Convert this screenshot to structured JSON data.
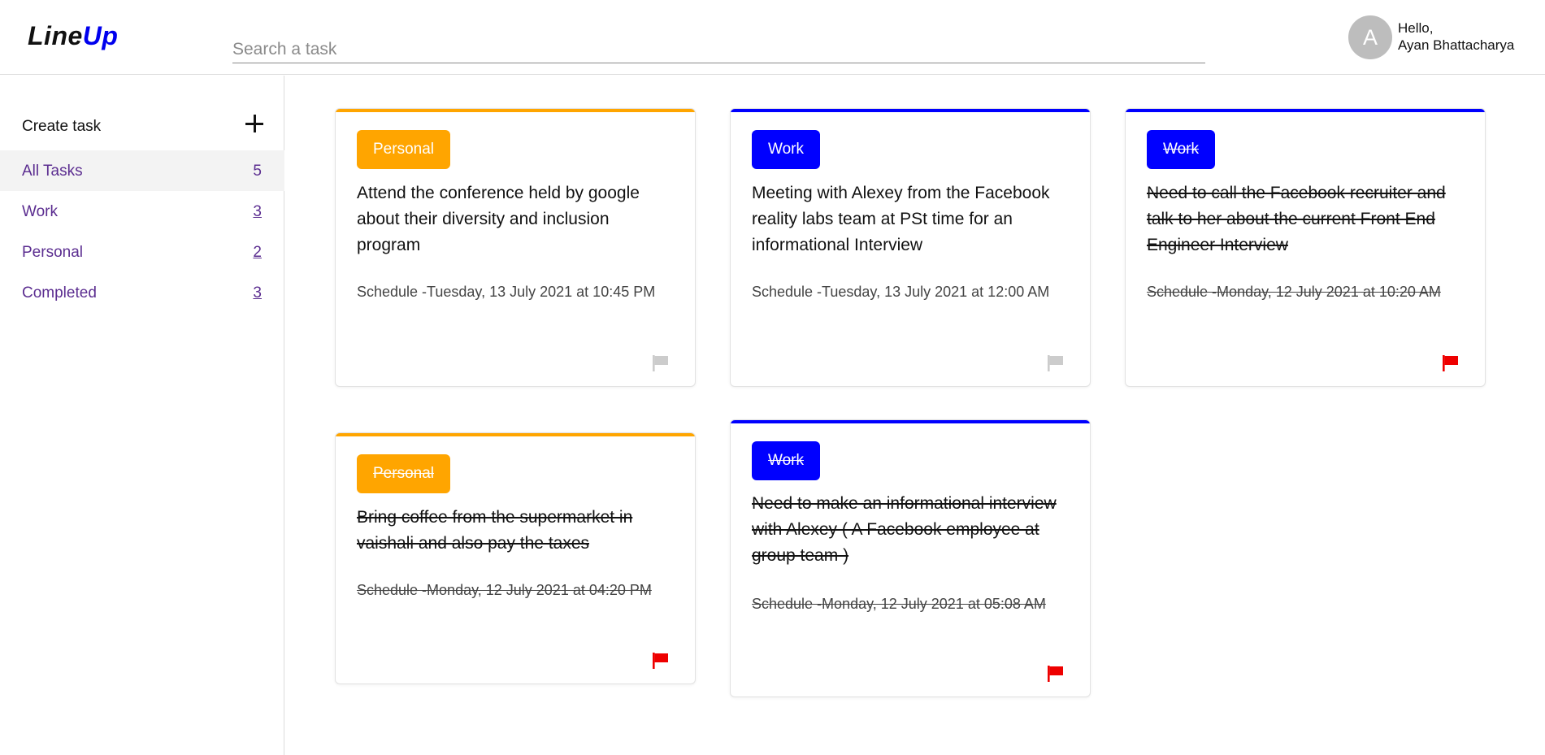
{
  "app": {
    "logo_part1": "Line",
    "logo_part2": "Up",
    "colors": {
      "accent_blue": "#0000ee",
      "nav_text": "#5b2d90",
      "work": "#0000ff",
      "personal": "#ffa500",
      "flag_on": "#ee0000",
      "flag_off": "#cccccc"
    }
  },
  "header": {
    "search_placeholder": "Search a task",
    "avatar_initial": "A",
    "greeting": "Hello,",
    "user_name": "Ayan Bhattacharya"
  },
  "sidebar": {
    "create_label": "Create task",
    "create_icon": "plus-icon",
    "items": [
      {
        "label": "All Tasks",
        "count": "5",
        "active": true
      },
      {
        "label": "Work",
        "count": "3",
        "active": false
      },
      {
        "label": "Personal",
        "count": "2",
        "active": false
      },
      {
        "label": "Completed",
        "count": "3",
        "active": false
      }
    ]
  },
  "tasks": [
    {
      "tag": "Personal",
      "title": "Attend the conference held by google about their diversity and inclusion program",
      "schedule": "Schedule -Tuesday, 13 July 2021 at 10:45 PM",
      "completed": false,
      "flagged": false
    },
    {
      "tag": "Work",
      "title": "Meeting with Alexey from the Facebook reality labs team at PSt time for an informational Interview",
      "schedule": "Schedule -Tuesday, 13 July 2021 at 12:00 AM",
      "completed": false,
      "flagged": false
    },
    {
      "tag": "Work",
      "title": "Need to call the Facebook recruiter and talk to her about the current Front End Engineer Interview",
      "schedule": "Schedule -Monday, 12 July 2021 at 10:20 AM",
      "completed": true,
      "flagged": true
    },
    {
      "tag": "Personal",
      "title": "Bring coffee from the supermarket in vaishali and also pay the taxes",
      "schedule": "Schedule -Monday, 12 July 2021 at 04:20 PM",
      "completed": true,
      "flagged": true
    },
    {
      "tag": "Work",
      "title": "Need to make an informational interview with Alexey ( A Facebook employee at group team )",
      "schedule": "Schedule -Monday, 12 July 2021 at 05:08 AM",
      "completed": true,
      "flagged": true
    }
  ]
}
